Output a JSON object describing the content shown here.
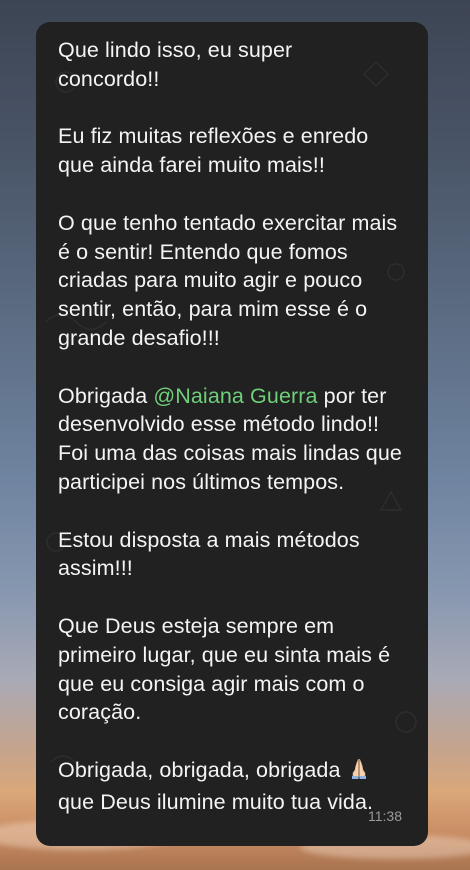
{
  "message": {
    "paragraphs": [
      {
        "lines": [
          "Que lindo isso, eu super",
          "concordo!!"
        ]
      },
      {
        "lines": [
          "Eu fiz muitas reflexões e enredo",
          "que ainda farei muito mais!!"
        ]
      },
      {
        "lines": [
          "O que tenho tentado exercitar mais",
          "é o sentir! Entendo que fomos",
          "criadas para muito agir e pouco",
          "sentir, então, para mim esse é o",
          "grande desafio!!!"
        ]
      },
      {
        "lines": [
          "por ter",
          "desenvolvido esse método lindo!!",
          "Foi uma das coisas mais lindas que",
          "participei nos últimos tempos."
        ],
        "prefix": "Obrigada",
        "mention": "@Naiana Guerra"
      },
      {
        "lines": [
          "Estou disposta a mais métodos",
          "assim!!!"
        ]
      },
      {
        "lines": [
          "Que Deus esteja sempre em",
          "primeiro lugar, que eu sinta mais é",
          "que eu consiga agir mais com o",
          "coração."
        ]
      },
      {
        "lines": [
          "Obrigada, obrigada, obrigada",
          "que Deus ilumine muito tua vida."
        ],
        "emoji": "praying-hands"
      }
    ],
    "time": "11:38"
  },
  "colors": {
    "bubble": "#212121",
    "text": "#f4f4f4",
    "mention": "#6fcf7a",
    "timestamp": "#9a9a9a"
  }
}
